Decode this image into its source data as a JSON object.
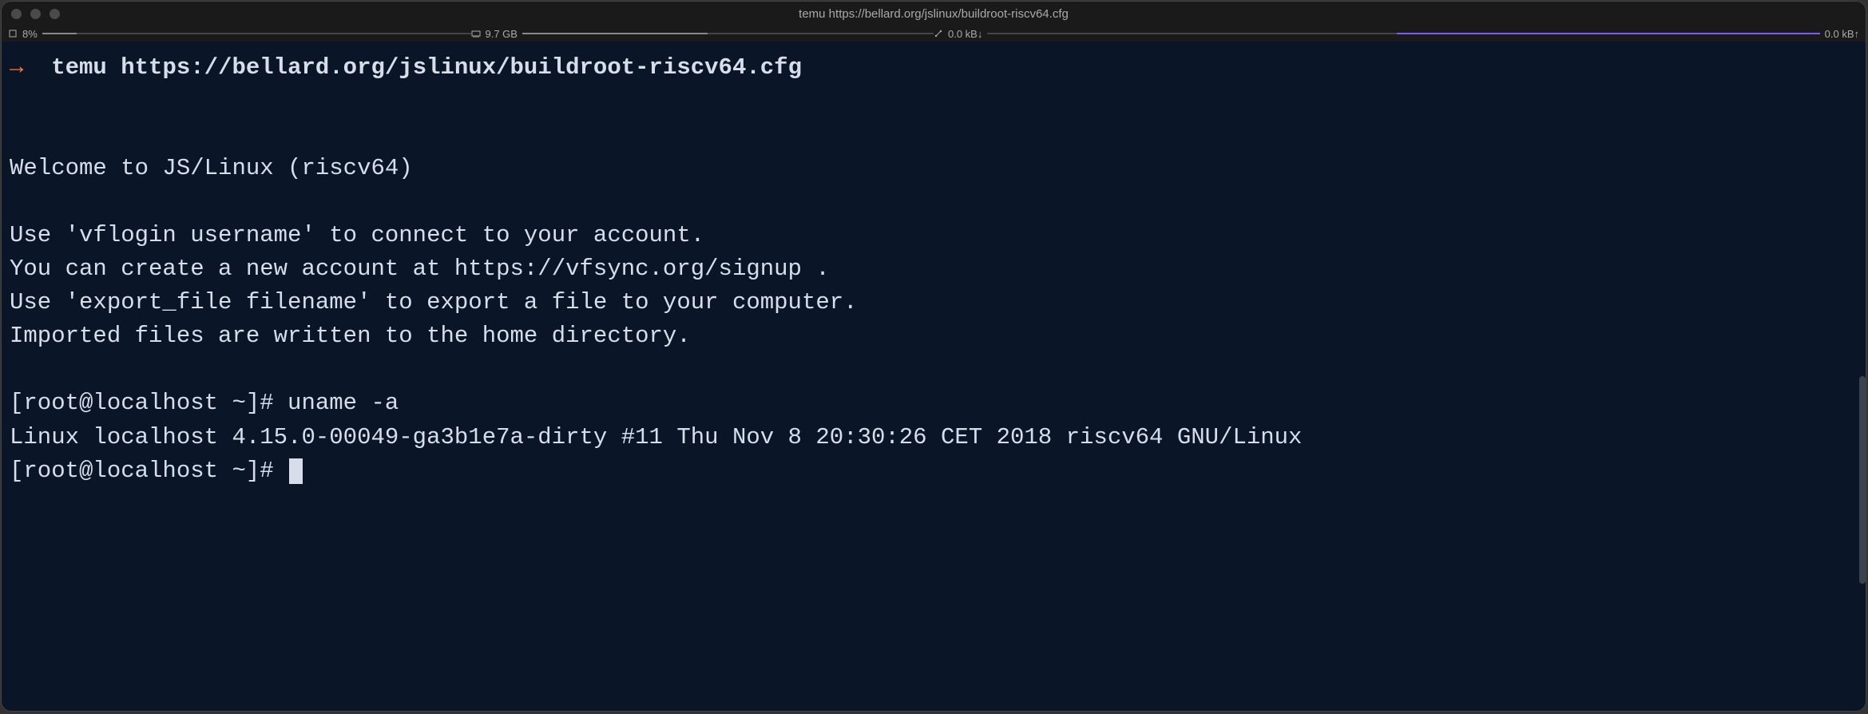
{
  "window": {
    "title": "temu https://bellard.org/jslinux/buildroot-riscv64.cfg"
  },
  "status": {
    "cpu": {
      "label": "8%",
      "fill_pct": 8
    },
    "memory": {
      "label": "9.7 GB",
      "fill_pct": 45
    },
    "net_down": {
      "label": "0.0 kB↓",
      "fill_pct": 0
    },
    "net_up": {
      "label": "0.0 kB↑",
      "fill_pct": 100
    }
  },
  "terminal": {
    "prompt_symbol": "→",
    "command": "temu https://bellard.org/jslinux/buildroot-riscv64.cfg",
    "lines": {
      "blank1": "",
      "blank2": "",
      "welcome": "Welcome to JS/Linux (riscv64)",
      "blank3": "",
      "hint1": "Use 'vflogin username' to connect to your account.",
      "hint2": "You can create a new account at https://vfsync.org/signup .",
      "hint3": "Use 'export_file filename' to export a file to your computer.",
      "hint4": "Imported files are written to the home directory.",
      "blank4": "",
      "prompt1": "[root@localhost ~]# uname -a",
      "uname_out": "Linux localhost 4.15.0-00049-ga3b1e7a-dirty #11 Thu Nov 8 20:30:26 CET 2018 riscv64 GNU/Linux",
      "prompt2": "[root@localhost ~]# "
    }
  }
}
